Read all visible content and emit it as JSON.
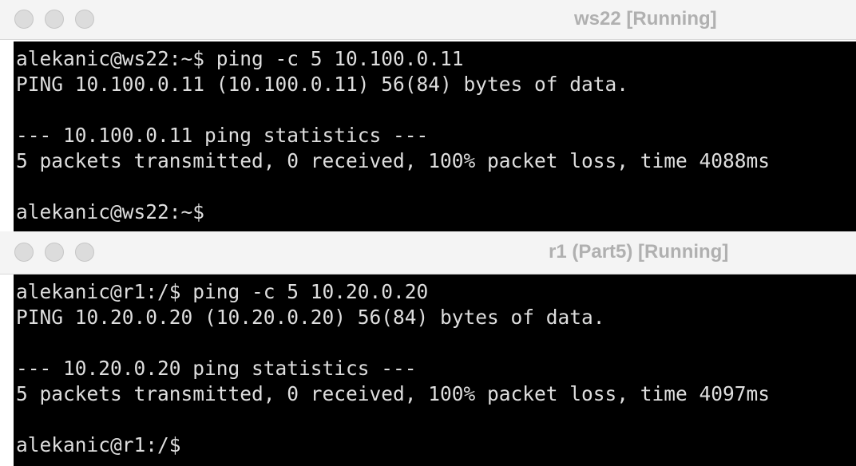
{
  "window1": {
    "title": "ws22 [Running]",
    "lines": [
      "alekanic@ws22:~$ ping -c 5 10.100.0.11",
      "PING 10.100.0.11 (10.100.0.11) 56(84) bytes of data.",
      "",
      "--- 10.100.0.11 ping statistics ---",
      "5 packets transmitted, 0 received, 100% packet loss, time 4088ms",
      "",
      "alekanic@ws22:~$"
    ]
  },
  "window2": {
    "title": "r1 (Part5) [Running]",
    "lines": [
      "alekanic@r1:/$ ping -c 5 10.20.0.20",
      "PING 10.20.0.20 (10.20.0.20) 56(84) bytes of data.",
      "",
      "--- 10.20.0.20 ping statistics ---",
      "5 packets transmitted, 0 received, 100% packet loss, time 4097ms",
      "",
      "alekanic@r1:/$"
    ]
  },
  "colors": {
    "terminal_bg": "#000000",
    "terminal_fg": "#dedede",
    "titlebar_bg": "#f4f4f4",
    "title_text": "#b0b0b0",
    "traffic_light": "#dcdcdc"
  }
}
